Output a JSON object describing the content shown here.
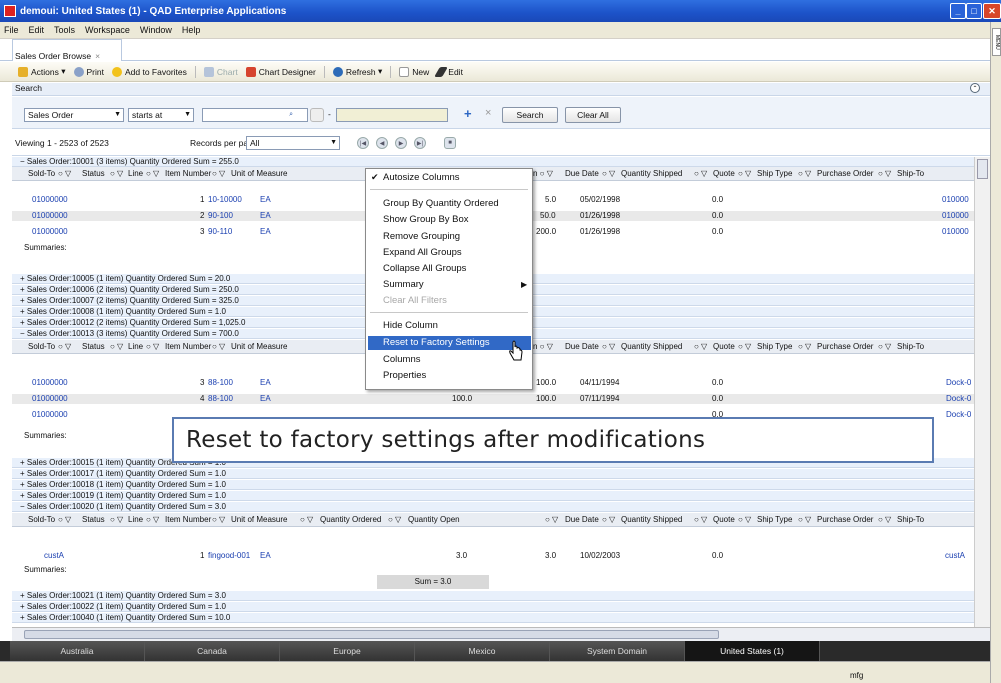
{
  "window": {
    "title": "demoui: United States (1) - QAD Enterprise Applications"
  },
  "menu": [
    "File",
    "Edit",
    "Tools",
    "Workspace",
    "Window",
    "Help"
  ],
  "side_tab": "MENU",
  "tab": {
    "label": "Sales Order Browse",
    "close": "×"
  },
  "toolbar": {
    "actions": "Actions",
    "print": "Print",
    "favorites": "Add to Favorites",
    "chart": "Chart",
    "designer": "Chart Designer",
    "refresh": "Refresh",
    "new": "New",
    "edit": "Edit"
  },
  "search": {
    "label": "Search",
    "field": "Sales Order",
    "operator": "starts at",
    "value": "",
    "dash": "-",
    "plus": "+",
    "x": "×",
    "search_button": "Search",
    "clear_button": "Clear All"
  },
  "viewing": {
    "text": "Viewing 1 - 2523 of 2523",
    "records_label": "Records per page:",
    "records_value": "All"
  },
  "columns": [
    "Sold-To",
    "Status",
    "Line",
    "Item Number",
    "Unit of Measure",
    "Quantity Ordered",
    "Quantity Open",
    "Due Date",
    "Quantity Shipped",
    "Quote",
    "Ship Type",
    "Purchase Order",
    "Ship-To"
  ],
  "groups": {
    "g1": "Sales Order:10001 (3 items) Quantity Ordered Sum = 255.0",
    "g5": "Sales Order:10005 (1 item) Quantity Ordered Sum = 20.0",
    "g6": "Sales Order:10006 (2 items) Quantity Ordered Sum = 250.0",
    "g7": "Sales Order:10007 (2 items) Quantity Ordered Sum = 325.0",
    "g8": "Sales Order:10008 (1 item) Quantity Ordered Sum = 1.0",
    "g12": "Sales Order:10012 (2 items) Quantity Ordered Sum = 1,025.0",
    "g13": "Sales Order:10013 (3 items) Quantity Ordered Sum = 700.0",
    "g15": "Sales Order:10015 (1 item) Quantity Ordered Sum = 1.0",
    "g17": "Sales Order:10017 (1 item) Quantity Ordered Sum = 1.0",
    "g18": "Sales Order:10018 (1 item) Quantity Ordered Sum = 1.0",
    "g19": "Sales Order:10019 (1 item) Quantity Ordered Sum = 1.0",
    "g20": "Sales Order:10020 (1 item) Quantity Ordered Sum = 3.0",
    "g21": "Sales Order:10021 (1 item) Quantity Ordered Sum = 3.0",
    "g22": "Sales Order:10022 (1 item) Quantity Ordered Sum = 1.0",
    "g40": "Sales Order:10040 (1 item) Quantity Ordered Sum = 10.0"
  },
  "rows_g1": [
    {
      "sold_to": "01000000",
      "line": "1",
      "item": "10-10000",
      "um": "EA",
      "qopen": "5.0",
      "due": "05/02/1998",
      "shipped": "0.0",
      "ship_to": "010000"
    },
    {
      "sold_to": "01000000",
      "line": "2",
      "item": "90-100",
      "um": "EA",
      "qopen": "50.0",
      "due": "01/26/1998",
      "shipped": "0.0",
      "ship_to": "010000"
    },
    {
      "sold_to": "01000000",
      "line": "3",
      "item": "90-110",
      "um": "EA",
      "qopen": "200.0",
      "due": "01/26/1998",
      "shipped": "0.0",
      "ship_to": "010000"
    }
  ],
  "rows_g13": [
    {
      "sold_to": "01000000",
      "line": "3",
      "item": "88-100",
      "um": "EA",
      "qord": "",
      "qopen": "100.0",
      "due": "04/11/1994",
      "shipped": "0.0",
      "ship_to": "Dock-0"
    },
    {
      "sold_to": "01000000",
      "line": "4",
      "item": "88-100",
      "um": "EA",
      "qord": "100.0",
      "qopen": "100.0",
      "due": "07/11/1994",
      "shipped": "0.0",
      "ship_to": "Dock-0"
    },
    {
      "sold_to": "01000000",
      "line": "",
      "item": "",
      "um": "",
      "qord": "",
      "qopen": "",
      "due": "",
      "shipped": "0.0",
      "ship_to": "Dock-0"
    }
  ],
  "rows_g20": [
    {
      "sold_to": "custA",
      "line": "1",
      "item": "fingood-001",
      "um": "EA",
      "qord": "3.0",
      "qopen": "3.0",
      "due": "10/02/2003",
      "shipped": "0.0",
      "ship_to": "custA"
    }
  ],
  "summaries_label": "Summaries:",
  "sum_g20": "Sum = 3.0",
  "context_menu": {
    "autosize": "Autosize Columns",
    "group_by": "Group By Quantity Ordered",
    "show_group_box": "Show Group By Box",
    "remove_grouping": "Remove Grouping",
    "expand_all": "Expand All Groups",
    "collapse_all": "Collapse All Groups",
    "summary": "Summary",
    "clear_filters": "Clear All Filters",
    "hide_column": "Hide Column",
    "reset": "Reset to Factory Settings",
    "columns": "Columns",
    "properties": "Properties"
  },
  "callout": "Reset to factory settings after modifications",
  "bottom_tabs": [
    "Australia",
    "Canada",
    "Europe",
    "Mexico",
    "System Domain",
    "United States (1)"
  ],
  "status": {
    "user": "mfg"
  },
  "colors": {
    "title_bar": "#1c52c8",
    "menu_highlight": "#3169c6",
    "link": "#1a3fb0",
    "group_row": "#e8f0fb"
  }
}
